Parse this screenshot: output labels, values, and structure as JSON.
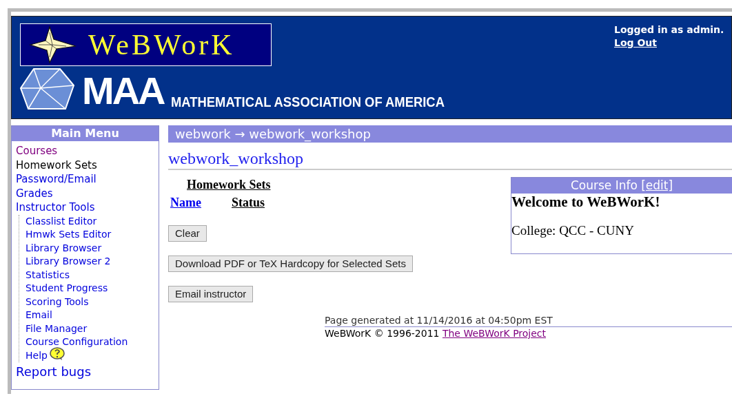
{
  "header": {
    "logo_text": "WeBWorK",
    "maa_text": "MAA",
    "maa_name": "MATHEMATICAL ASSOCIATION OF AMERICA",
    "login_text": "Logged in as admin.",
    "logout_link": "Log Out"
  },
  "sidebar": {
    "title": "Main Menu",
    "items": [
      {
        "label": "Courses",
        "kind": "visited"
      },
      {
        "label": "Homework Sets",
        "kind": "current"
      },
      {
        "label": "Password/Email",
        "kind": "link"
      },
      {
        "label": "Grades",
        "kind": "link"
      },
      {
        "label": "Instructor Tools",
        "kind": "link",
        "children": [
          {
            "label": "Classlist Editor",
            "kind": "link"
          },
          {
            "label": "Hmwk Sets Editor",
            "kind": "link"
          },
          {
            "label": "Library Browser",
            "kind": "link"
          },
          {
            "label": "Library Browser 2",
            "kind": "link"
          },
          {
            "label": "Statistics",
            "kind": "link"
          },
          {
            "label": "Student Progress",
            "kind": "link"
          },
          {
            "label": "Scoring Tools",
            "kind": "link"
          },
          {
            "label": "Email",
            "kind": "link"
          },
          {
            "label": "File Manager",
            "kind": "link"
          },
          {
            "label": "Course Configuration",
            "kind": "link"
          },
          {
            "label": "Help",
            "kind": "help"
          }
        ]
      }
    ],
    "report_link": "Report bugs"
  },
  "breadcrumb": "webwork → webwork_workshop",
  "page_title": "webwork_workshop",
  "sets_table": {
    "caption": "Homework Sets",
    "columns": [
      {
        "label": "Name",
        "kind": "link"
      },
      {
        "label": "Status",
        "kind": "plain"
      }
    ]
  },
  "buttons": [
    "Clear",
    "Download PDF or TeX Hardcopy for Selected Sets",
    "Email instructor"
  ],
  "course_info": {
    "title": "Course Info",
    "edit_link": "[edit]",
    "welcome": "Welcome to WeBWorK!",
    "college": "College: QCC - CUNY"
  },
  "footer": {
    "generated": "Page generated at 11/14/2016 at 04:50pm EST",
    "copyright": "WeBWorK © 1996-2011",
    "project_link": "The WeBWorK Project"
  }
}
